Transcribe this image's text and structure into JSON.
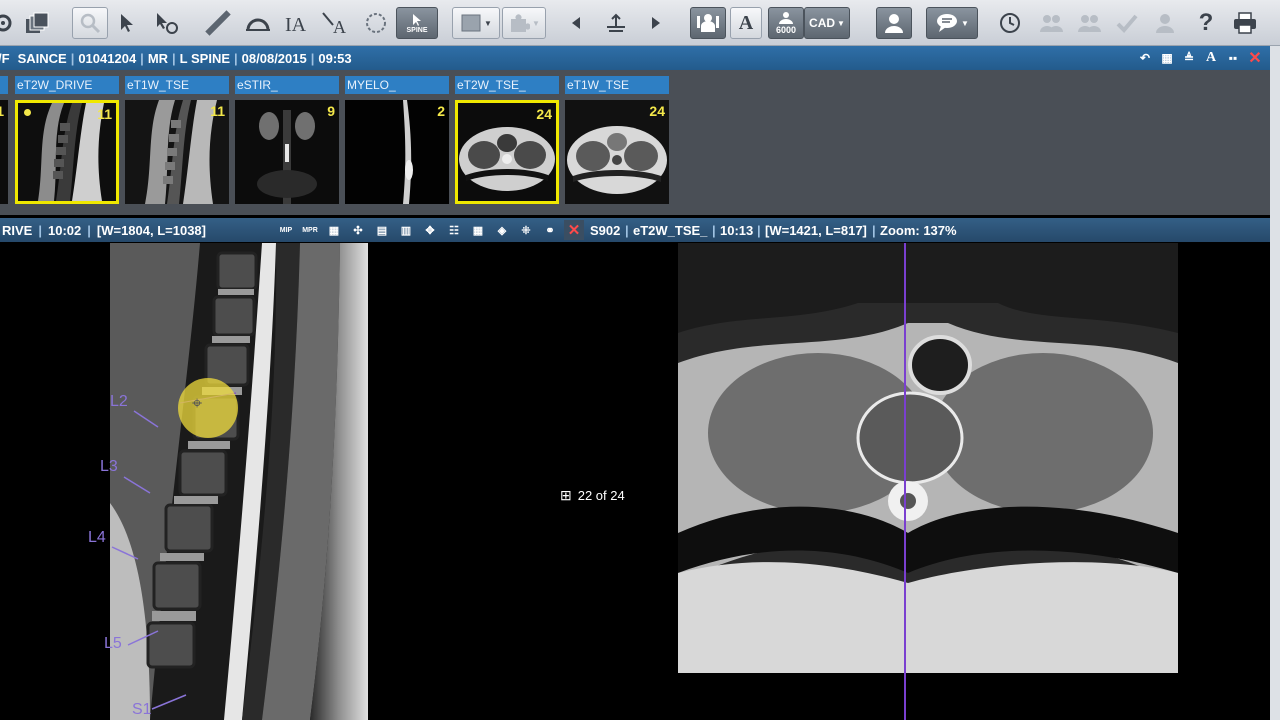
{
  "toolbar": {
    "icons": [
      "settings-icon",
      "layers-icon",
      "magnifier-icon",
      "pointer-icon",
      "select-icon",
      "ruler-icon",
      "angle-icon",
      "text-annotation-icon",
      "arrow-annotation-icon",
      "ellipse-icon",
      "spine-label-icon",
      "rectangle-icon",
      "puzzle-icon",
      "previous-icon",
      "scale-icon",
      "next-icon",
      "people-icon",
      "text-icon",
      "counter-icon",
      "cad-icon",
      "user-icon",
      "chat-icon",
      "history-icon",
      "group-icon",
      "group2-icon",
      "check-icon",
      "person-icon",
      "help-icon",
      "print-icon"
    ],
    "spine_label": "SPINE",
    "text_label": "A",
    "counter_label": "6000",
    "cad_label": "CAD",
    "help_label": "?"
  },
  "patient": {
    "prefix": "/F",
    "name": "SAINCE",
    "id": "01041204",
    "modality": "MR",
    "body_part": "L SPINE",
    "date": "08/08/2015",
    "time": "09:53"
  },
  "series": [
    {
      "label": "eT2W_DRIVE",
      "count": "11",
      "selected": true
    },
    {
      "label": "eT1W_TSE",
      "count": "11",
      "selected": false
    },
    {
      "label": "eSTIR_",
      "count": "9",
      "selected": false
    },
    {
      "label": "MYELO_",
      "count": "2",
      "selected": false
    },
    {
      "label": "eT2W_TSE_",
      "count": "24",
      "selected": true
    },
    {
      "label": "eT1W_TSE",
      "count": "24",
      "selected": false
    }
  ],
  "partial_first_count": "1",
  "left_view": {
    "series_name": "RIVE",
    "time": "10:02",
    "window": "[W=1804, L=1038]",
    "spine_labels": [
      "L2",
      "L3",
      "L4",
      "L5",
      "S1"
    ]
  },
  "right_view": {
    "series_id": "S902",
    "series_name": "eT2W_TSE_",
    "time": "10:13",
    "window": "[W=1421, L=817]",
    "zoom": "Zoom: 137%",
    "position": "22 of 24"
  },
  "viewbar_tools": [
    "MIP",
    "MPR"
  ],
  "colors": {
    "thumb_label": "#2e7fc4",
    "selected_border": "#f0e800",
    "spine_label": "#8a74d8",
    "reference_line": "#7a3fd0",
    "close": "#ff4a4a"
  }
}
